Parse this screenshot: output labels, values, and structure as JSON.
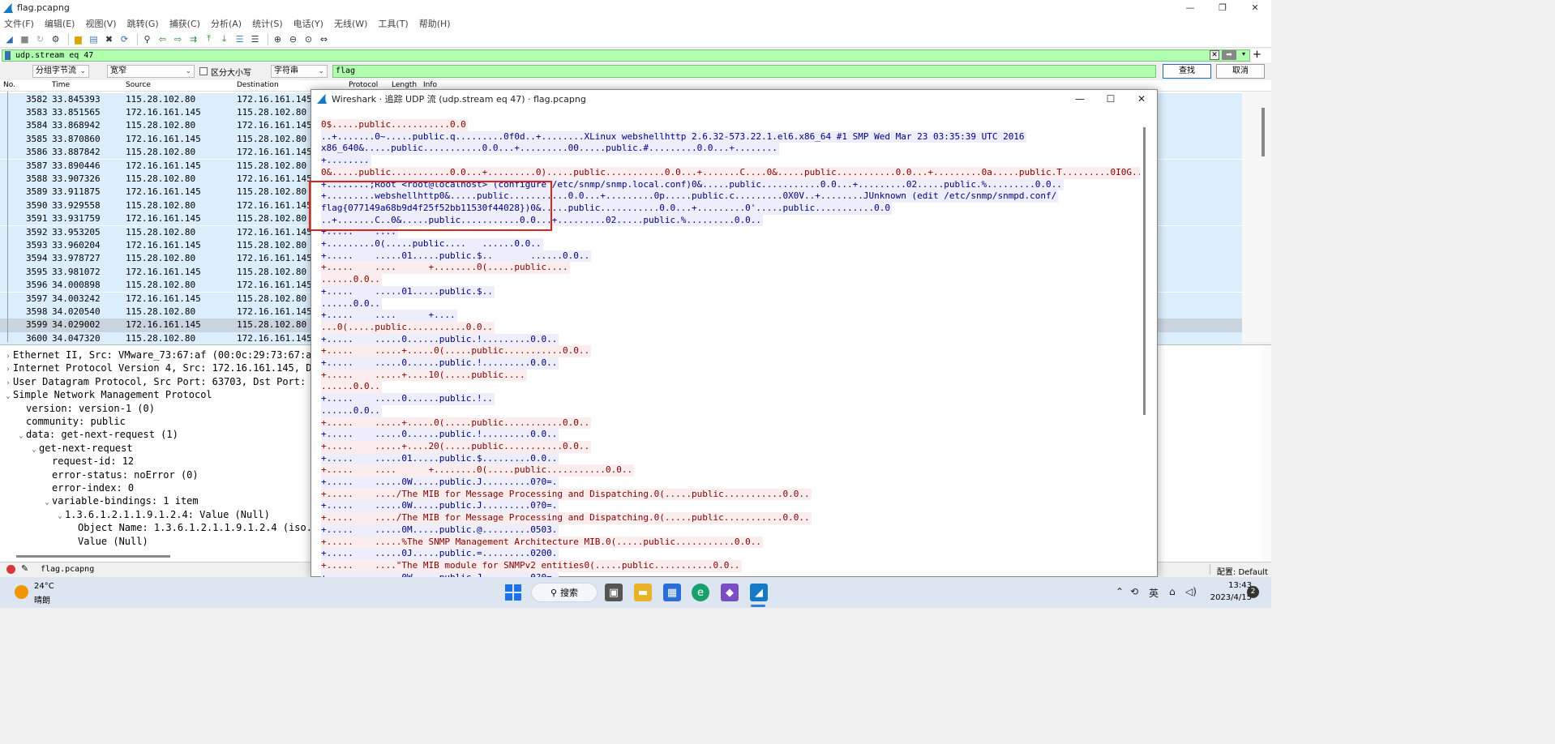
{
  "window": {
    "title": "flag.pcapng"
  },
  "menu": [
    "文件(F)",
    "编辑(E)",
    "视图(V)",
    "跳转(G)",
    "捕获(C)",
    "分析(A)",
    "统计(S)",
    "电话(Y)",
    "无线(W)",
    "工具(T)",
    "帮助(H)"
  ],
  "filter": {
    "value": "udp.stream eq 47"
  },
  "find": {
    "scope": "分组字节流",
    "charset": "宽窄",
    "case_label": "区分大小写",
    "type": "字符串",
    "value": "flag",
    "find_label": "查找",
    "cancel_label": "取消"
  },
  "packet_list": {
    "headers": [
      "No.",
      "Time",
      "Source",
      "Destination",
      "Protocol",
      "Length",
      "Info"
    ],
    "rows": [
      {
        "no": "3582",
        "time": "33.845393",
        "src": "115.28.102.80",
        "dst": "172.16.161.145"
      },
      {
        "no": "3583",
        "time": "33.851565",
        "src": "172.16.161.145",
        "dst": "115.28.102.80"
      },
      {
        "no": "3584",
        "time": "33.868942",
        "src": "115.28.102.80",
        "dst": "172.16.161.145"
      },
      {
        "no": "3585",
        "time": "33.870860",
        "src": "172.16.161.145",
        "dst": "115.28.102.80"
      },
      {
        "no": "3586",
        "time": "33.887842",
        "src": "115.28.102.80",
        "dst": "172.16.161.145"
      },
      {
        "no": "3587",
        "time": "33.890446",
        "src": "172.16.161.145",
        "dst": "115.28.102.80"
      },
      {
        "no": "3588",
        "time": "33.907326",
        "src": "115.28.102.80",
        "dst": "172.16.161.145"
      },
      {
        "no": "3589",
        "time": "33.911875",
        "src": "172.16.161.145",
        "dst": "115.28.102.80"
      },
      {
        "no": "3590",
        "time": "33.929558",
        "src": "115.28.102.80",
        "dst": "172.16.161.145"
      },
      {
        "no": "3591",
        "time": "33.931759",
        "src": "172.16.161.145",
        "dst": "115.28.102.80"
      },
      {
        "no": "3592",
        "time": "33.953205",
        "src": "115.28.102.80",
        "dst": "172.16.161.145"
      },
      {
        "no": "3593",
        "time": "33.960204",
        "src": "172.16.161.145",
        "dst": "115.28.102.80"
      },
      {
        "no": "3594",
        "time": "33.978727",
        "src": "115.28.102.80",
        "dst": "172.16.161.145"
      },
      {
        "no": "3595",
        "time": "33.981072",
        "src": "172.16.161.145",
        "dst": "115.28.102.80"
      },
      {
        "no": "3596",
        "time": "34.000898",
        "src": "115.28.102.80",
        "dst": "172.16.161.145"
      },
      {
        "no": "3597",
        "time": "34.003242",
        "src": "172.16.161.145",
        "dst": "115.28.102.80"
      },
      {
        "no": "3598",
        "time": "34.020540",
        "src": "115.28.102.80",
        "dst": "172.16.161.145"
      },
      {
        "no": "3599",
        "time": "34.029002",
        "src": "172.16.161.145",
        "dst": "115.28.102.80"
      },
      {
        "no": "3600",
        "time": "34.047320",
        "src": "115.28.102.80",
        "dst": "172.16.161.145"
      }
    ]
  },
  "details": [
    {
      "indent": 0,
      "tw": ">",
      "text": "Ethernet II, Src: VMware_73:67:af (00:0c:29:73:67:af), D"
    },
    {
      "indent": 0,
      "tw": ">",
      "text": "Internet Protocol Version 4, Src: 172.16.161.145, Dst: 1"
    },
    {
      "indent": 0,
      "tw": ">",
      "text": "User Datagram Protocol, Src Port: 63703, Dst Port: 161"
    },
    {
      "indent": 0,
      "tw": "v",
      "text": "Simple Network Management Protocol"
    },
    {
      "indent": 1,
      "tw": "",
      "text": "version: version-1 (0)"
    },
    {
      "indent": 1,
      "tw": "",
      "text": "community: public"
    },
    {
      "indent": 1,
      "tw": "v",
      "text": "data: get-next-request (1)"
    },
    {
      "indent": 2,
      "tw": "v",
      "text": "get-next-request"
    },
    {
      "indent": 3,
      "tw": "",
      "text": "request-id: 12"
    },
    {
      "indent": 3,
      "tw": "",
      "text": "error-status: noError (0)"
    },
    {
      "indent": 3,
      "tw": "",
      "text": "error-index: 0"
    },
    {
      "indent": 3,
      "tw": "v",
      "text": "variable-bindings: 1 item"
    },
    {
      "indent": 4,
      "tw": "v",
      "text": "1.3.6.1.2.1.1.9.1.2.4: Value (Null)"
    },
    {
      "indent": 5,
      "tw": "",
      "text": "Object Name: 1.3.6.1.2.1.1.9.1.2.4 (iso.3.6"
    },
    {
      "indent": 5,
      "tw": "",
      "text": "Value (Null)"
    }
  ],
  "status": {
    "file": "flag.pcapng",
    "profile": "配置: Default"
  },
  "dialog": {
    "title": "Wireshark · 追踪 UDP 流 (udp.stream eq 47) · flag.pcapng",
    "lines": [
      {
        "c": "cli",
        "t": "0$.....public...........0.0"
      },
      {
        "c": "srv",
        "t": "..+.......0~.....public.q.........0f0d..+........XLinux webshellhttp 2.6.32-573.22.1.el6.x86_64 #1 SMP Wed Mar 23 03:35:39 UTC 2016"
      },
      {
        "c": "srv",
        "t": "x86_640&.....public...........0.0...+.........00.....public.#.........0.0...+........"
      },
      {
        "c": "srv",
        "t": "+........"
      },
      {
        "c": "cli",
        "t": "0&.....public...........0.0...+.........0).....public...........0.0...+.......C....0&.....public...........0.0...+.........0a.....public.T.........0I0G.."
      },
      {
        "c": "srv",
        "t": "+........;Root <root@localhost> (configure /etc/snmp/snmp.local.conf)0&.....public...........0.0...+.........02.....public.%.........0.0.."
      },
      {
        "c": "srv",
        "t": "+.........webshellhttp0&.....public...........0.0...+.........0p.....public.c.........0X0V..+........JUnknown (edit /etc/snmp/snmpd.conf/"
      },
      {
        "c": "srv",
        "t": "flag{077149a68b9d4f25f52bb11530f44028})0&.....public...........0.0...+.........0'.....public...........0.0"
      },
      {
        "c": "srv",
        "t": "..+.......C..0&.....public...........0.0...+.........02.....public.%.........0.0.."
      },
      {
        "c": "srv",
        "t": "+.....    ...."
      },
      {
        "c": "srv",
        "t": "+.........0(.....public....   ......0.0.."
      },
      {
        "c": "srv",
        "t": "+.....    .....01.....public.$..       ......0.0.."
      },
      {
        "c": "cli",
        "t": "+.....    ....      +........0(.....public...."
      },
      {
        "c": "cli",
        "t": "......0.0.."
      },
      {
        "c": "srv",
        "t": "+.....    .....01.....public.$.."
      },
      {
        "c": "srv",
        "t": "......0.0.."
      },
      {
        "c": "srv",
        "t": "+.....    ....      +...."
      },
      {
        "c": "cli",
        "t": "...0(.....public...........0.0.."
      },
      {
        "c": "srv",
        "t": "+.....    .....0......public.!.........0.0.."
      },
      {
        "c": "cli",
        "t": "+.....    .....+.....0(.....public...........0.0.."
      },
      {
        "c": "srv",
        "t": "+.....    .....0......public.!.........0.0.."
      },
      {
        "c": "cli",
        "t": "+.....    .....+....10(.....public...."
      },
      {
        "c": "cli",
        "t": "......0.0.."
      },
      {
        "c": "srv",
        "t": "+.....    .....0......public.!.."
      },
      {
        "c": "srv",
        "t": "......0.0.."
      },
      {
        "c": "cli",
        "t": "+.....    .....+.....0(.....public...........0.0.."
      },
      {
        "c": "srv",
        "t": "+.....    .....0......public.!.........0.0.."
      },
      {
        "c": "cli",
        "t": "+.....    .....+....20(.....public...........0.0.."
      },
      {
        "c": "srv",
        "t": "+.....    .....01.....public.$.........0.0.."
      },
      {
        "c": "cli",
        "t": "+.....    ....      +........0(.....public...........0.0.."
      },
      {
        "c": "srv",
        "t": "+.....    .....0W.....public.J.........0?0=."
      },
      {
        "c": "cli",
        "t": "+.....    ..../The MIB for Message Processing and Dispatching.0(.....public...........0.0.."
      },
      {
        "c": "srv",
        "t": "+.....    .....0W.....public.J.........0?0=."
      },
      {
        "c": "cli",
        "t": "+.....    ..../The MIB for Message Processing and Dispatching.0(.....public...........0.0.."
      },
      {
        "c": "srv",
        "t": "+.....    .....0M.....public.@.........0503."
      },
      {
        "c": "cli",
        "t": "+.....    .....%The SNMP Management Architecture MIB.0(.....public...........0.0.."
      },
      {
        "c": "srv",
        "t": "+.....    .....0J.....public.=.........0200."
      },
      {
        "c": "cli",
        "t": "+.....    ....\"The MIB module for SNMPv2 entities0(.....public...........0.0.."
      },
      {
        "c": "srv",
        "t": "+.....    .....0W.....public.J.........0?0=."
      }
    ]
  },
  "taskbar": {
    "temp": "24°C",
    "condition": "晴朗",
    "search_label": "搜索",
    "time": "13:43",
    "date": "2023/4/15",
    "ime": "英",
    "notifications": "2"
  }
}
